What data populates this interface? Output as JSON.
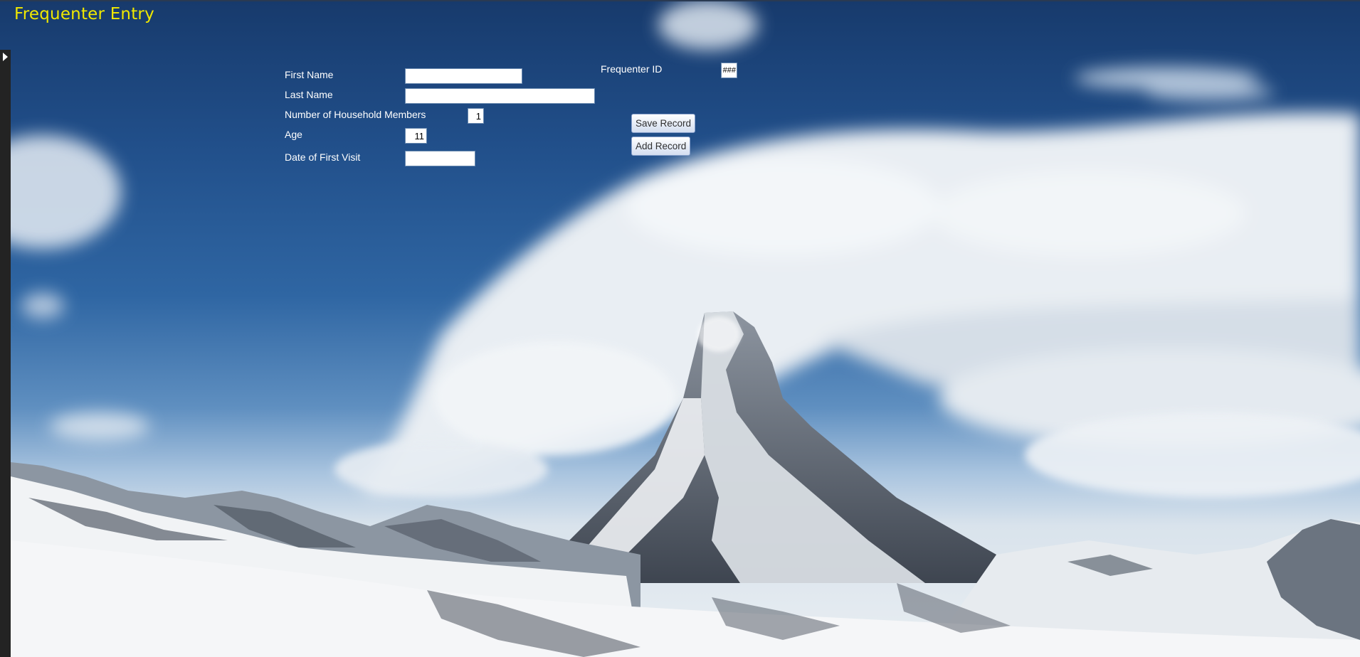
{
  "form": {
    "title": "Frequenter Entry",
    "fields": {
      "first_name": {
        "label": "First Name",
        "value": ""
      },
      "last_name": {
        "label": "Last Name",
        "value": ""
      },
      "household_members": {
        "label": "Number of Household Members",
        "value": "1"
      },
      "age": {
        "label": "Age",
        "value": "11"
      },
      "first_visit": {
        "label": "Date of First Visit",
        "value": ""
      },
      "frequenter_id": {
        "label": "Frequenter ID",
        "value": "###"
      }
    },
    "buttons": {
      "save": "Save Record",
      "add": "Add Record"
    }
  },
  "background": {
    "subject": "snow-capped-mountain-peak-with-clouds",
    "sky_color": "#214f8a",
    "title_color": "#f0e800"
  }
}
